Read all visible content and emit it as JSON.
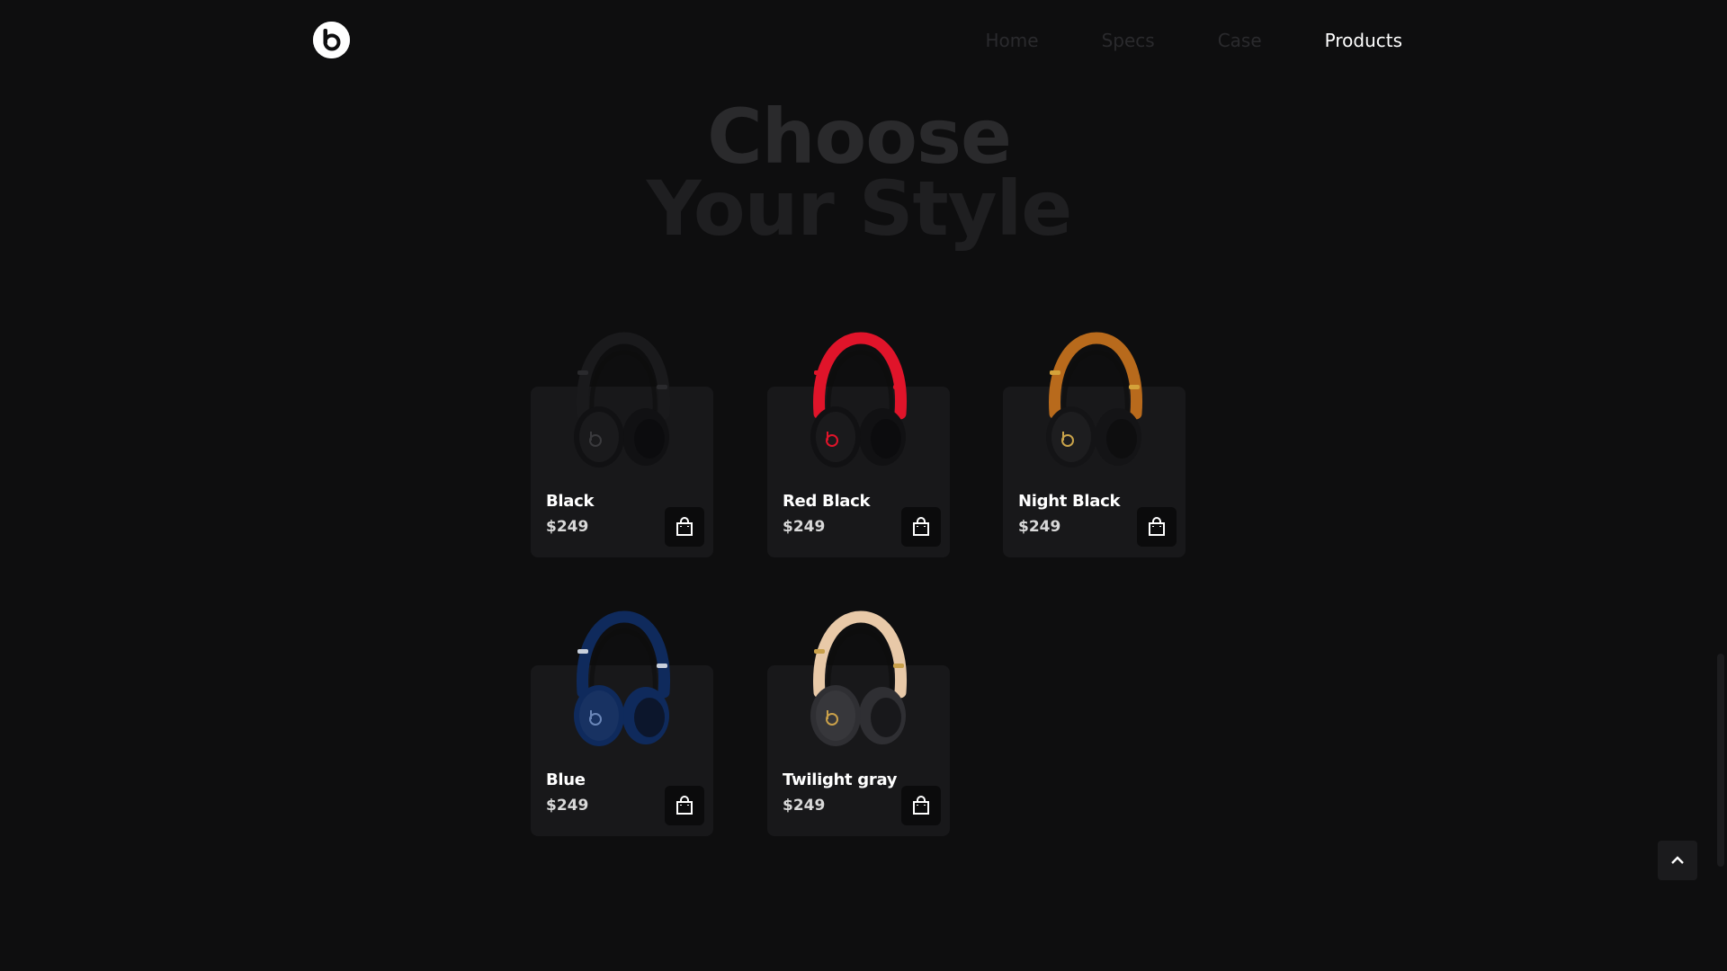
{
  "header": {
    "nav": [
      {
        "label": "Home",
        "active": false
      },
      {
        "label": "Specs",
        "active": false
      },
      {
        "label": "Case",
        "active": false
      },
      {
        "label": "Products",
        "active": true
      }
    ]
  },
  "hero": {
    "line1": "Choose",
    "line2": "Your Style"
  },
  "products": [
    {
      "name": "Black",
      "price": "$249",
      "band": "#1a1a1c",
      "cup": "#111113",
      "accent": "#2a2a2d",
      "logo": "#3a3a3d"
    },
    {
      "name": "Red Black",
      "price": "$249",
      "band": "#e0142a",
      "cup": "#111113",
      "accent": "#e0142a",
      "logo": "#e0142a"
    },
    {
      "name": "Night Black",
      "price": "$249",
      "band": "#b86a1c",
      "cup": "#141416",
      "accent": "#d4a23a",
      "logo": "#c9a34a"
    },
    {
      "name": "Blue",
      "price": "$249",
      "band": "#0f2a5c",
      "cup": "#0f2a5c",
      "accent": "#c9d0dc",
      "logo": "#6a86b8"
    },
    {
      "name": "Twilight gray",
      "price": "$249",
      "band": "#e8c9a8",
      "cup": "#2f2f33",
      "accent": "#c9a04a",
      "logo": "#c9a04a"
    }
  ],
  "colors": {
    "background": "#0e0e0f",
    "card": "#18181a",
    "nav_inactive": "#2a2a2d",
    "nav_active": "#ffffff"
  },
  "icons": {
    "logo": "beats-logo-icon",
    "bag": "shopping-bag-icon",
    "scroll_top": "chevron-up-icon"
  }
}
